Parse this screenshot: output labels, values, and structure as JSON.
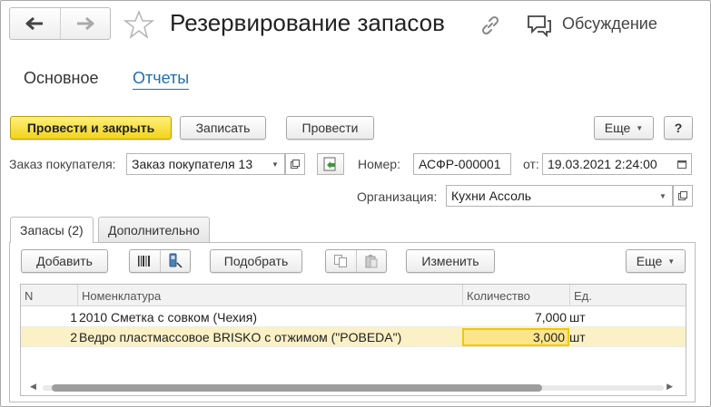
{
  "header": {
    "title": "Резервирование запасов",
    "discussion_label": "Обсуждение",
    "back_icon": "arrow-left-icon",
    "forward_icon": "arrow-right-icon",
    "favorite_icon": "star-icon",
    "link_icon": "link-icon",
    "discussion_icon": "chat-icon"
  },
  "top_tabs": {
    "main": "Основное",
    "reports": "Отчеты"
  },
  "toolbar": {
    "post_close": "Провести и закрыть",
    "save": "Записать",
    "post": "Провести",
    "more": "Еще",
    "help": "?"
  },
  "form": {
    "customer_order_label": "Заказ покупателя:",
    "customer_order_value": "Заказ покупателя 13",
    "number_label": "Номер:",
    "number_value": "АСФР-000001",
    "date_label": "от:",
    "date_value": "19.03.2021  2:24:00",
    "organization_label": "Организация:",
    "organization_value": "Кухни Ассоль"
  },
  "tabs": {
    "stocks": "Запасы (2)",
    "additional": "Дополнительно"
  },
  "table_toolbar": {
    "add": "Добавить",
    "pick": "Подобрать",
    "change": "Изменить",
    "more": "Еще"
  },
  "table": {
    "columns": [
      "N",
      "Номенклатура",
      "Количество",
      "Ед."
    ],
    "rows": [
      {
        "n": "1",
        "item": "2010 Сметка с совком (Чехия)",
        "qty": "7,000",
        "unit": "шт"
      },
      {
        "n": "2",
        "item": "Ведро пластмассовое BRISKO с отжимом (\"POBEDA\")",
        "qty": "3,000",
        "unit": "шт"
      }
    ]
  },
  "colors": {
    "primary_button": "#f2d31c",
    "link": "#1f6fb4",
    "selected_row": "#fbf1c6",
    "focus_cell": "#fde58c"
  }
}
